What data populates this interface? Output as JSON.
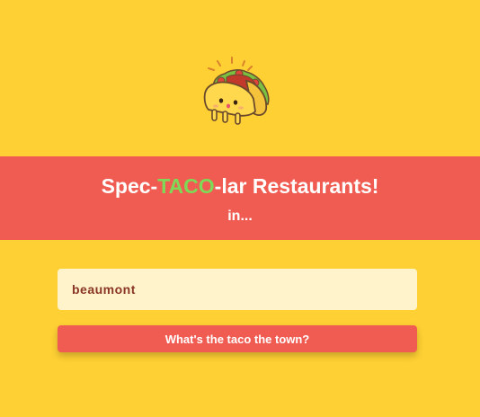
{
  "logo": {
    "icon": "taco-mascot-icon"
  },
  "header": {
    "title_prefix": "Spec-",
    "title_accent": "TACO",
    "title_suffix": "-lar Restaurants!",
    "subtitle": "in..."
  },
  "search": {
    "value": "beaumont",
    "button_label": "What's the taco the town?"
  },
  "colors": {
    "background": "#ffd034",
    "banner": "#f05c52",
    "accent_green": "#7ed957",
    "input_bg": "#fff3cc",
    "input_text": "#8a3524"
  }
}
